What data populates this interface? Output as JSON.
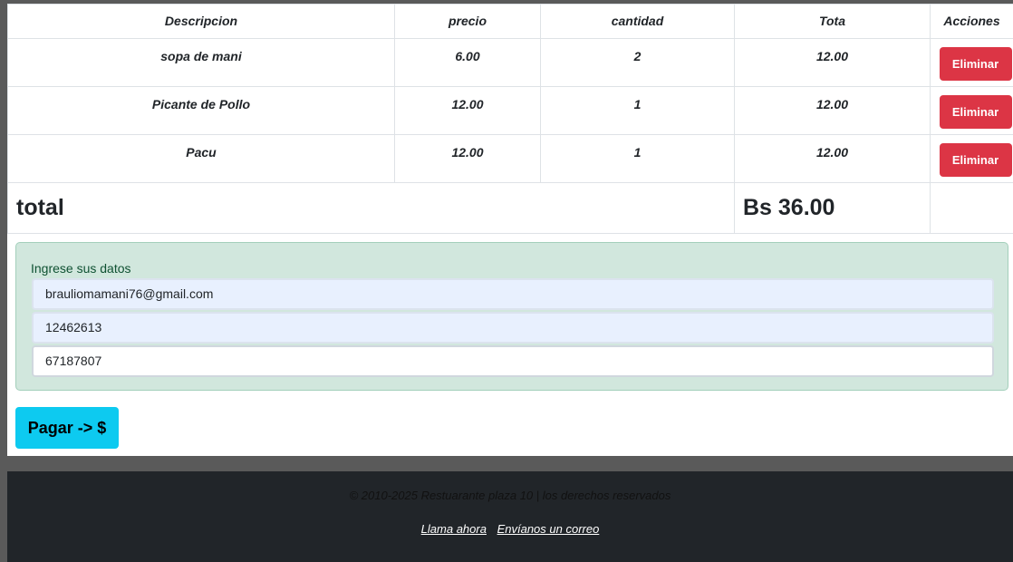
{
  "table": {
    "headers": [
      "Descripcion",
      "precio",
      "cantidad",
      "Tota",
      "Acciones"
    ],
    "rows": [
      {
        "description": "sopa de mani",
        "price": "6.00",
        "quantity": "2",
        "total": "12.00",
        "action": "Eliminar"
      },
      {
        "description": "Picante de Pollo",
        "price": "12.00",
        "quantity": "1",
        "total": "12.00",
        "action": "Eliminar"
      },
      {
        "description": "Pacu",
        "price": "12.00",
        "quantity": "1",
        "total": "12.00",
        "action": "Eliminar"
      }
    ],
    "total_label": "total",
    "total_value": "Bs 36.00"
  },
  "form": {
    "label": "Ingrese sus datos",
    "email": "brauliomamani76@gmail.com",
    "ci": "12462613",
    "phone": "67187807"
  },
  "pay_button": "Pagar -> $",
  "footer": {
    "copyright": "© 2010-2025 Restuarante plaza 10 | los derechos reservados",
    "call_link": "Llama ahora",
    "mail_link": "Envíanos un correo"
  },
  "colors": {
    "danger": "#dc3545",
    "info": "#0dcaf0",
    "success_bg": "#d1e7dd",
    "footer_bg": "#212529"
  }
}
